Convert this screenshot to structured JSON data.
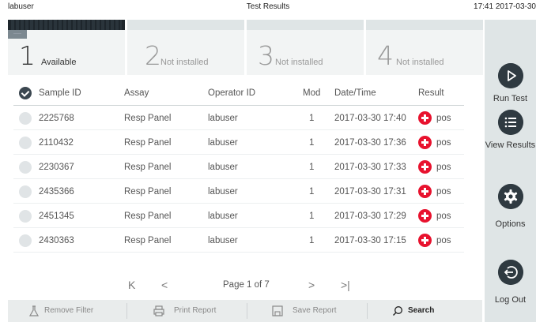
{
  "status": {
    "user": "labuser",
    "title": "Test Results",
    "time": "17:41 2017-03-30"
  },
  "tabs": [
    {
      "num": "1",
      "label": "Available",
      "tag": "·····"
    },
    {
      "num": "2",
      "label": "Not installed"
    },
    {
      "num": "3",
      "label": "Not installed"
    },
    {
      "num": "4",
      "label": "Not installed"
    }
  ],
  "table": {
    "headers": {
      "sample": "Sample ID",
      "assay": "Assay",
      "operator": "Operator ID",
      "mod": "Mod",
      "datetime": "Date/Time",
      "result": "Result"
    },
    "rows": [
      {
        "sample": "2225768",
        "assay": "Resp Panel",
        "operator": "labuser",
        "mod": "1",
        "datetime": "2017-03-30 17:40",
        "result": "pos"
      },
      {
        "sample": "2110432",
        "assay": "Resp Panel",
        "operator": "labuser",
        "mod": "1",
        "datetime": "2017-03-30 17:36",
        "result": "pos"
      },
      {
        "sample": "2230367",
        "assay": "Resp Panel",
        "operator": "labuser",
        "mod": "1",
        "datetime": "2017-03-30 17:33",
        "result": "pos"
      },
      {
        "sample": "2435366",
        "assay": "Resp Panel",
        "operator": "labuser",
        "mod": "1",
        "datetime": "2017-03-30 17:31",
        "result": "pos"
      },
      {
        "sample": "2451345",
        "assay": "Resp Panel",
        "operator": "labuser",
        "mod": "1",
        "datetime": "2017-03-30 17:29",
        "result": "pos"
      },
      {
        "sample": "2430363",
        "assay": "Resp Panel",
        "operator": "labuser",
        "mod": "1",
        "datetime": "2017-03-30 17:15",
        "result": "pos"
      }
    ]
  },
  "pager": {
    "first": "K",
    "prev": "<",
    "text": "Page 1 of 7",
    "next": ">",
    "last": ">|"
  },
  "footer": {
    "remove_filter": "Remove Filter",
    "print_report": "Print Report",
    "save_report": "Save Report",
    "search": "Search"
  },
  "sidebar": {
    "run_test": "Run Test",
    "view_results": "View Results",
    "options": "Options",
    "log_out": "Log Out"
  },
  "colors": {
    "positive": "#e8122e",
    "sidebar_bg": "#dfe5e6",
    "icon_dark": "#2f3a41"
  }
}
